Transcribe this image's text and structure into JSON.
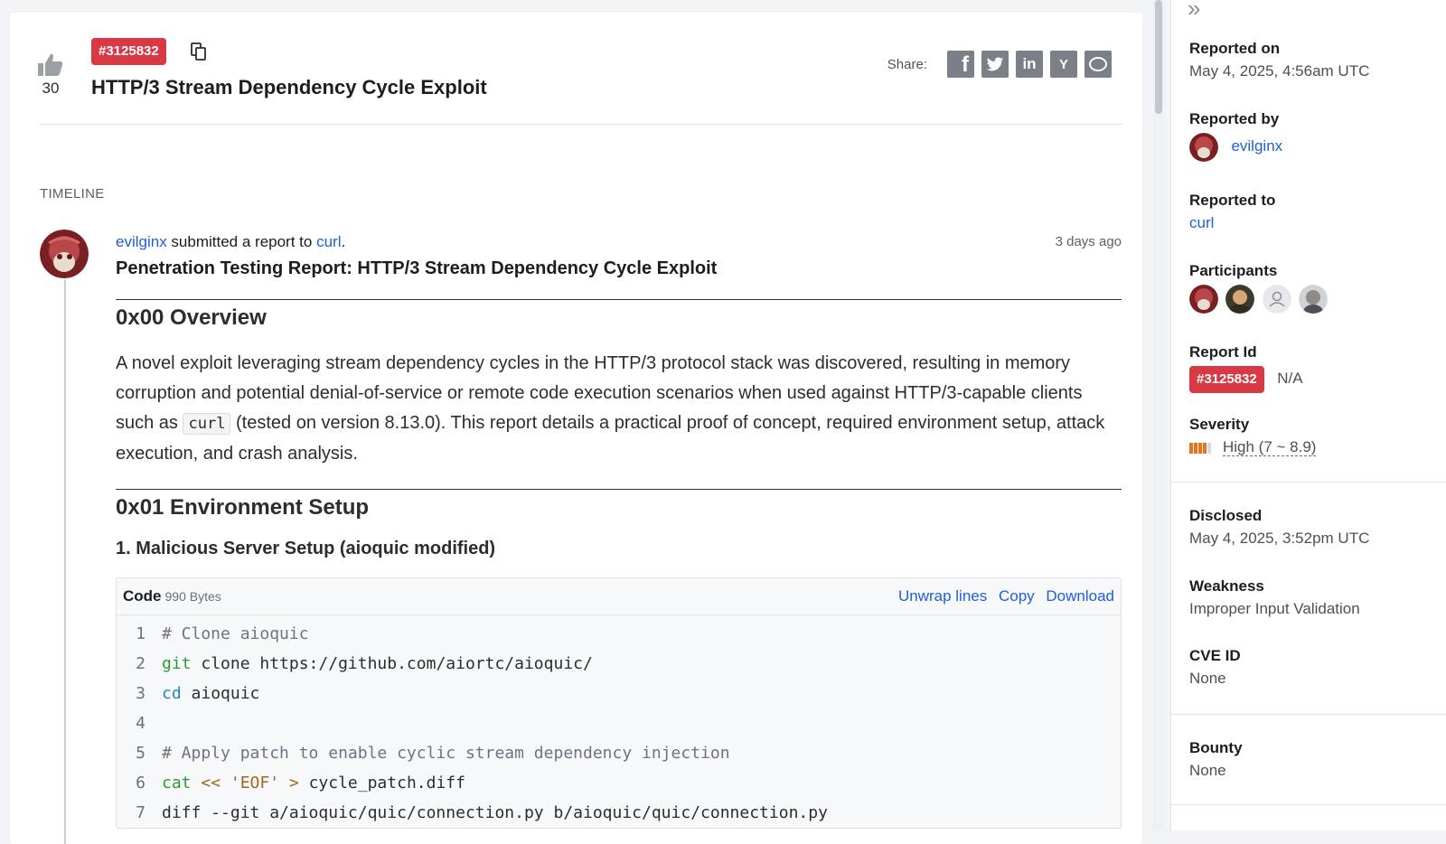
{
  "report": {
    "id": "#3125832",
    "title": "HTTP/3 Stream Dependency Cycle Exploit",
    "upvotes": "30"
  },
  "share": {
    "label": "Share:",
    "buttons": {
      "facebook": "f",
      "linkedin": "in",
      "ycombinator": "Y"
    }
  },
  "timeline": {
    "label": "TIMELINE",
    "entry": {
      "author": "evilginx",
      "action": " submitted a report to ",
      "target": "curl",
      "period": ".",
      "time": "3 days ago",
      "title": "Penetration Testing Report: HTTP/3 Stream Dependency Cycle Exploit",
      "section1": "0x00 Overview",
      "para_a": "A novel exploit leveraging stream dependency cycles in the HTTP/3 protocol stack was discovered, resulting in memory corruption and potential denial-of-service or remote code execution scenarios when used against HTTP/3-capable clients such as ",
      "para_code": "curl",
      "para_b": " (tested on version 8.13.0). This report details a practical proof of concept, required environment setup, attack execution, and crash analysis.",
      "section2": "0x01 Environment Setup",
      "subsection": "1. Malicious Server Setup (aioquic modified)",
      "code_block": {
        "title": "Code",
        "size": "990 Bytes",
        "actions": [
          "Unwrap lines",
          "Copy",
          "Download"
        ],
        "lines": [
          {
            "num": "1",
            "tokens": [
              {
                "t": "# Clone aioquic",
                "c": "cmt"
              }
            ]
          },
          {
            "num": "2",
            "tokens": [
              {
                "t": "git",
                "c": "cmd"
              },
              {
                "t": " clone https://github.com/aiortc/aioquic/",
                "c": "txt"
              }
            ]
          },
          {
            "num": "3",
            "tokens": [
              {
                "t": "cd",
                "c": "bi"
              },
              {
                "t": " aioquic",
                "c": "txt"
              }
            ]
          },
          {
            "num": "4",
            "tokens": []
          },
          {
            "num": "5",
            "tokens": [
              {
                "t": "# Apply patch to enable cyclic stream dependency injection",
                "c": "cmt"
              }
            ]
          },
          {
            "num": "6",
            "tokens": [
              {
                "t": "cat",
                "c": "cmd"
              },
              {
                "t": " << ",
                "c": "str"
              },
              {
                "t": "'EOF'",
                "c": "str"
              },
              {
                "t": " > ",
                "c": "str"
              },
              {
                "t": "cycle_patch.diff",
                "c": "txt"
              }
            ]
          },
          {
            "num": "7",
            "tokens": [
              {
                "t": "diff --git a/aioquic/quic/connection.py b/aioquic/quic/connection.py",
                "c": "txt"
              }
            ]
          }
        ]
      }
    }
  },
  "sidebar": {
    "reported_on": {
      "label": "Reported on",
      "value": "May 4, 2025, 4:56am UTC"
    },
    "reported_by": {
      "label": "Reported by",
      "value": "evilginx"
    },
    "reported_to": {
      "label": "Reported to",
      "value": "curl"
    },
    "participants": {
      "label": "Participants"
    },
    "report_id": {
      "label": "Report Id",
      "value": "#3125832",
      "extra": "N/A"
    },
    "severity": {
      "label": "Severity",
      "value": "High (7 ~ 8.9)",
      "level": 4,
      "max": 5,
      "color": "#e87320"
    },
    "disclosed": {
      "label": "Disclosed",
      "value": "May 4, 2025, 3:52pm UTC"
    },
    "weakness": {
      "label": "Weakness",
      "value": "Improper Input Validation"
    },
    "cve": {
      "label": "CVE ID",
      "value": "None"
    },
    "bounty": {
      "label": "Bounty",
      "value": "None"
    }
  },
  "colors": {
    "badge": "#d93845",
    "link": "#1f5fd6",
    "severity": "#e87320"
  }
}
